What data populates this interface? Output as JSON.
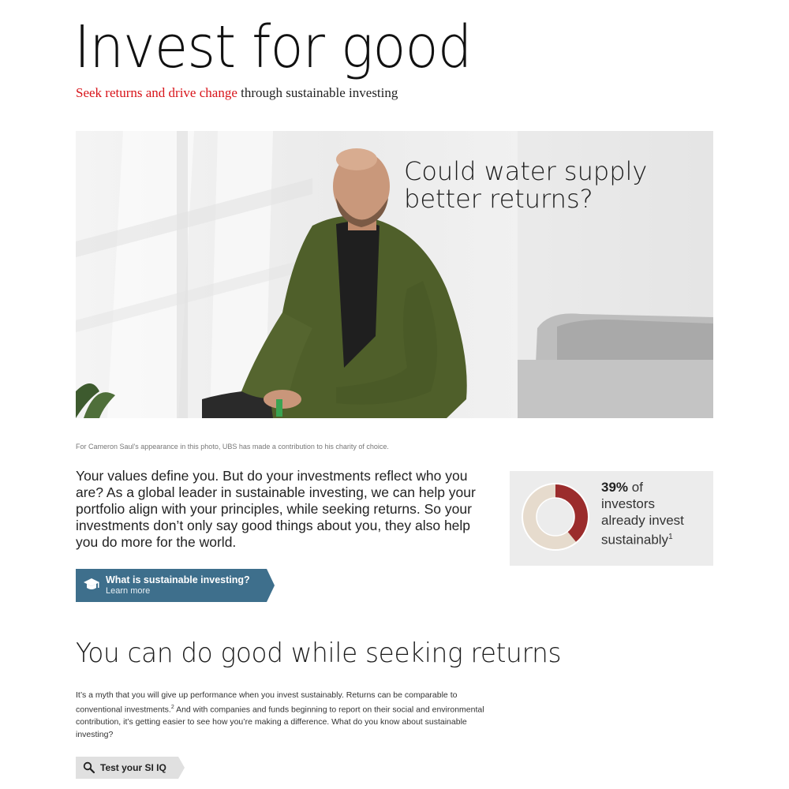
{
  "header": {
    "title": "Invest for good",
    "subtitle_highlight": "Seek returns and drive change",
    "subtitle_rest": " through sustainable investing"
  },
  "hero": {
    "headline_line1": "Could water supply",
    "headline_line2": "better returns?",
    "caption": "For Cameron Saul's appearance in this photo, UBS has made a contribution to his charity of choice."
  },
  "intro": {
    "text": "Your values define you. But do your investments reflect who you are? As a global leader in sustainable investing, we can help your portfolio align with your principles, while seeking returns. So your investments don’t only say good things about you, they also help you do more for the world."
  },
  "stat": {
    "percent_label": "39%",
    "text_after_percent": " of",
    "line2": "investors",
    "line3": "already invest",
    "line4": "sustainably",
    "footnote": "1",
    "fraction": 0.39,
    "colors": {
      "filled": "#9b2c2c",
      "remaining": "#e6dbcd"
    }
  },
  "cta_learn": {
    "title": "What is sustainable investing?",
    "subtitle": "Learn more",
    "icon": "graduation-cap-icon",
    "color": "#3e6f8c"
  },
  "section": {
    "title": "You can do good while seeking returns",
    "body_part1": "It’s a myth that you will give up performance when you invest sustainably. Returns can be comparable to conventional investments.",
    "footnote": "2",
    "body_part2": " And with companies and funds beginning to report on their social and environmental contribution, it’s getting easier to see how you’re making a difference. What do you know about sustainable investing?"
  },
  "cta_test": {
    "label": "Test your SI IQ",
    "icon": "magnifier-icon"
  },
  "colors": {
    "brand_red": "#d8141a",
    "cta_blue": "#3e6f8c",
    "stat_box_bg": "#ececec"
  }
}
